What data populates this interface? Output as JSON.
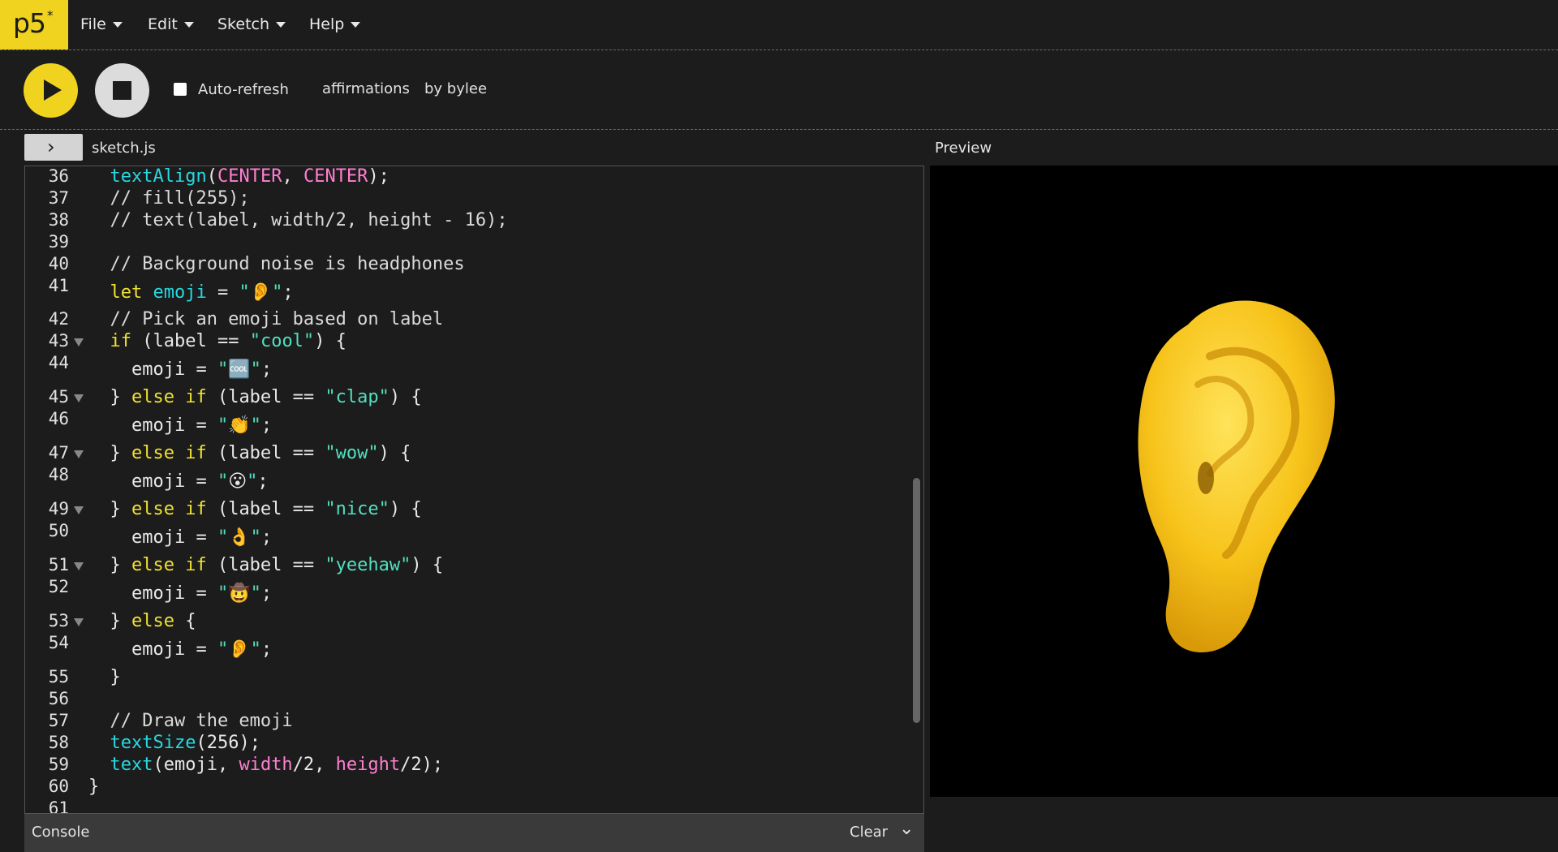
{
  "nav": {
    "logo_text": "p5",
    "logo_star": "*",
    "menus": [
      "File",
      "Edit",
      "Sketch",
      "Help"
    ]
  },
  "toolbar": {
    "play_icon": "play-icon",
    "stop_icon": "stop-icon",
    "auto_refresh_label": "Auto-refresh",
    "auto_refresh_checked": false,
    "sketch_name": "affirmations",
    "author": "by bylee"
  },
  "editor": {
    "file_name": "sketch.js",
    "line_numbers": [
      "36",
      "37",
      "38",
      "39",
      "40",
      "41",
      "42",
      "43",
      "44",
      "45",
      "46",
      "47",
      "48",
      "49",
      "50",
      "51",
      "52",
      "53",
      "54",
      "55",
      "56",
      "57",
      "58",
      "59",
      "60",
      "61"
    ],
    "emoji_cool": "🆒",
    "emoji_clap": "👏",
    "emoji_wow": "😮",
    "emoji_nice": "👌",
    "emoji_yeehaw": "🤠",
    "emoji_ear": "👂",
    "emoji_default": "👂"
  },
  "preview": {
    "label": "Preview",
    "content_icon": "ear-emoji"
  },
  "console": {
    "label": "Console",
    "clear_label": "Clear"
  },
  "colors": {
    "accent": "#f0d31e",
    "background": "#1c1c1c",
    "string": "#50e0c0",
    "keyword": "#f0e130",
    "function": "#28d8e0",
    "constant": "#ff7fd0"
  }
}
